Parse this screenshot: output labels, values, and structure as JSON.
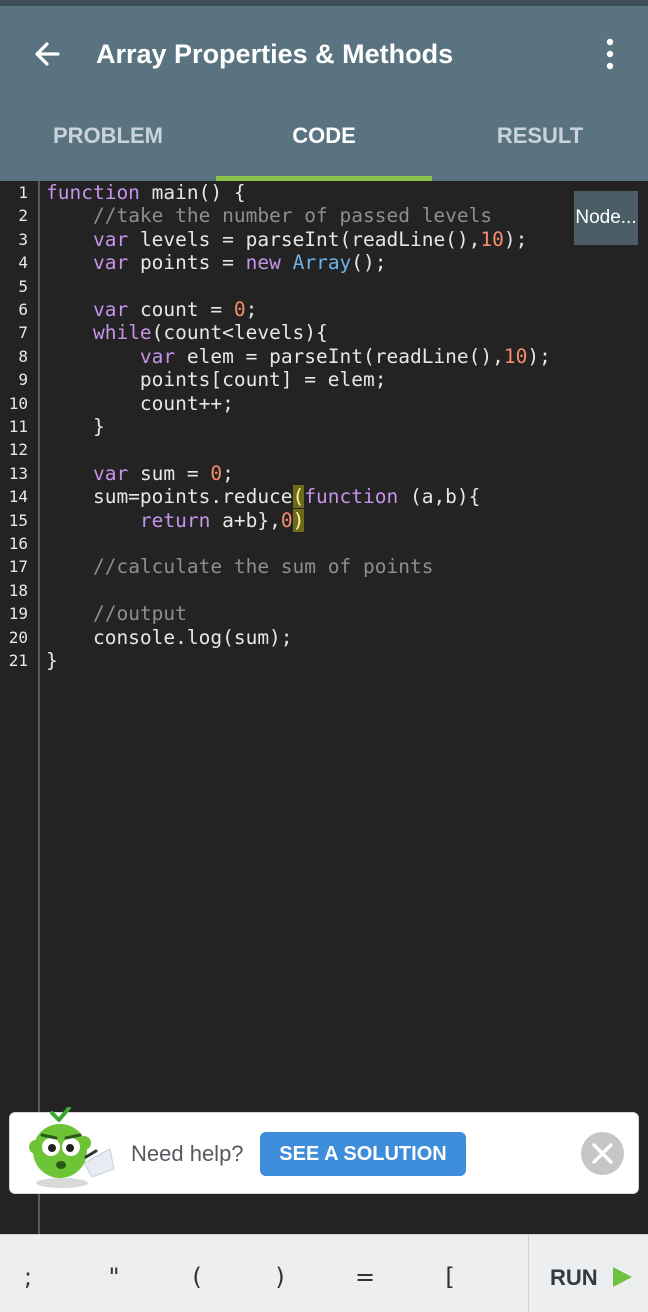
{
  "header": {
    "title": "Array Properties & Methods",
    "back_icon": "arrow-left-icon",
    "menu_icon": "more-vertical-icon",
    "background": "#5a7380"
  },
  "tabs": [
    {
      "label": "PROBLEM",
      "active": false
    },
    {
      "label": "CODE",
      "active": true
    },
    {
      "label": "RESULT",
      "active": false
    }
  ],
  "accent_color": "#8bc34a",
  "editor": {
    "language_badge": "Node...",
    "line_numbers": [
      "1",
      "2",
      "3",
      "4",
      "5",
      "6",
      "7",
      "8",
      "9",
      "10",
      "11",
      "12",
      "13",
      "14",
      "15",
      "16",
      "17",
      "18",
      "19",
      "20",
      "21"
    ],
    "lines": [
      "function main() {",
      "    //take the number of passed levels",
      "    var levels = parseInt(readLine(),10);",
      "    var points = new Array();",
      "",
      "    var count = 0;",
      "    while(count<levels){",
      "        var elem = parseInt(readLine(),10);",
      "        points[count] = elem;",
      "        count++;",
      "    }",
      "",
      "    var sum = 0;",
      "    sum=points.reduce(function (a,b){",
      "        return a+b},0)",
      "",
      "    //calculate the sum of points",
      "",
      "    //output",
      "    console.log(sum);",
      "}"
    ]
  },
  "help": {
    "mascot_icon": "mascot-icon",
    "text": "Need help?",
    "button_label": "SEE A SOLUTION",
    "close_icon": "close-icon"
  },
  "keyboard": {
    "keys": [
      ";",
      "\"",
      "(",
      ")",
      "=",
      "["
    ],
    "run_label": "RUN",
    "run_icon": "play-icon"
  }
}
